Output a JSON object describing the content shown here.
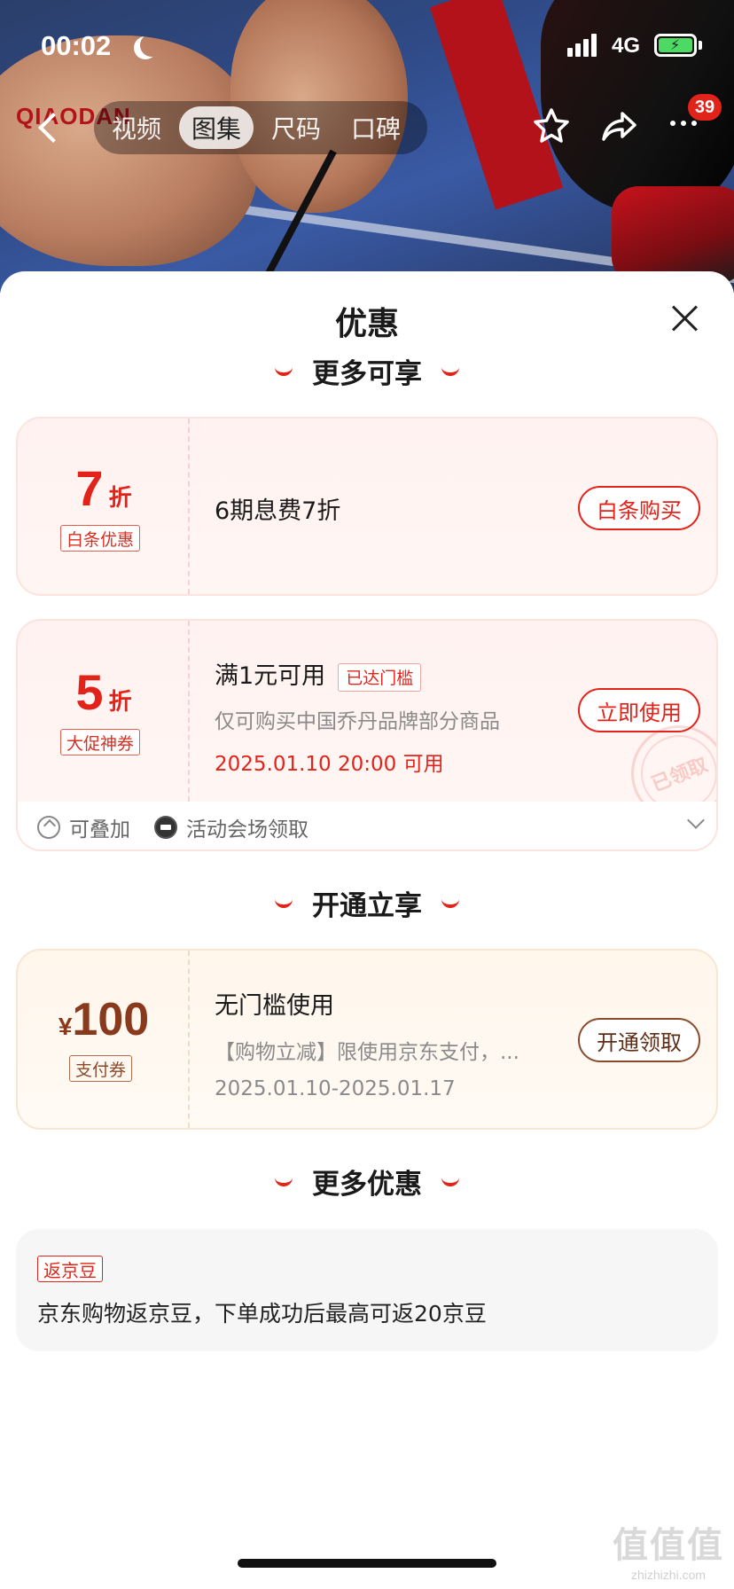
{
  "status_bar": {
    "time": "00:02",
    "network": "4G"
  },
  "hero": {
    "brand_text": "QIAODAN"
  },
  "nav": {
    "tabs": [
      {
        "label": "视频",
        "active": false
      },
      {
        "label": "图集",
        "active": true
      },
      {
        "label": "尺码",
        "active": false
      },
      {
        "label": "口碑",
        "active": false
      }
    ],
    "badge_count": "39"
  },
  "sheet": {
    "title": "优惠",
    "sections": {
      "more_enjoy": "更多可享",
      "open_enjoy": "开通立享",
      "more_offers": "更多优惠"
    }
  },
  "cards": {
    "baitiao": {
      "discount": "7",
      "unit": "折",
      "tag": "白条优惠",
      "title": "6期息费7折",
      "button": "白条购买"
    },
    "promo": {
      "discount": "5",
      "unit": "折",
      "tag": "大促神券",
      "title": "满1元可用",
      "threshold": "已达门槛",
      "desc": "仅可购买中国乔丹品牌部分商品",
      "date": "2025.01.10 20:00 可用",
      "button": "立即使用",
      "stamp": "已领取",
      "footer": {
        "stackable": "可叠加",
        "source": "活动会场领取"
      }
    },
    "pay": {
      "currency": "¥",
      "amount": "100",
      "tag": "支付券",
      "title": "无门槛使用",
      "desc": "【购物立减】限使用京东支付，...",
      "date": "2025.01.10-2025.01.17",
      "button": "开通领取"
    }
  },
  "more_offers": {
    "tag": "返京豆",
    "text": "京东购物返京豆，下单成功后最高可返20京豆"
  },
  "watermark": {
    "logo": "值值值",
    "url": "zhizhizhi.com"
  },
  "colors": {
    "accent": "#e2231a",
    "brown": "#8a3a1c",
    "pink_bg": "#fff2f0",
    "cream_bg": "#fff6ec"
  }
}
